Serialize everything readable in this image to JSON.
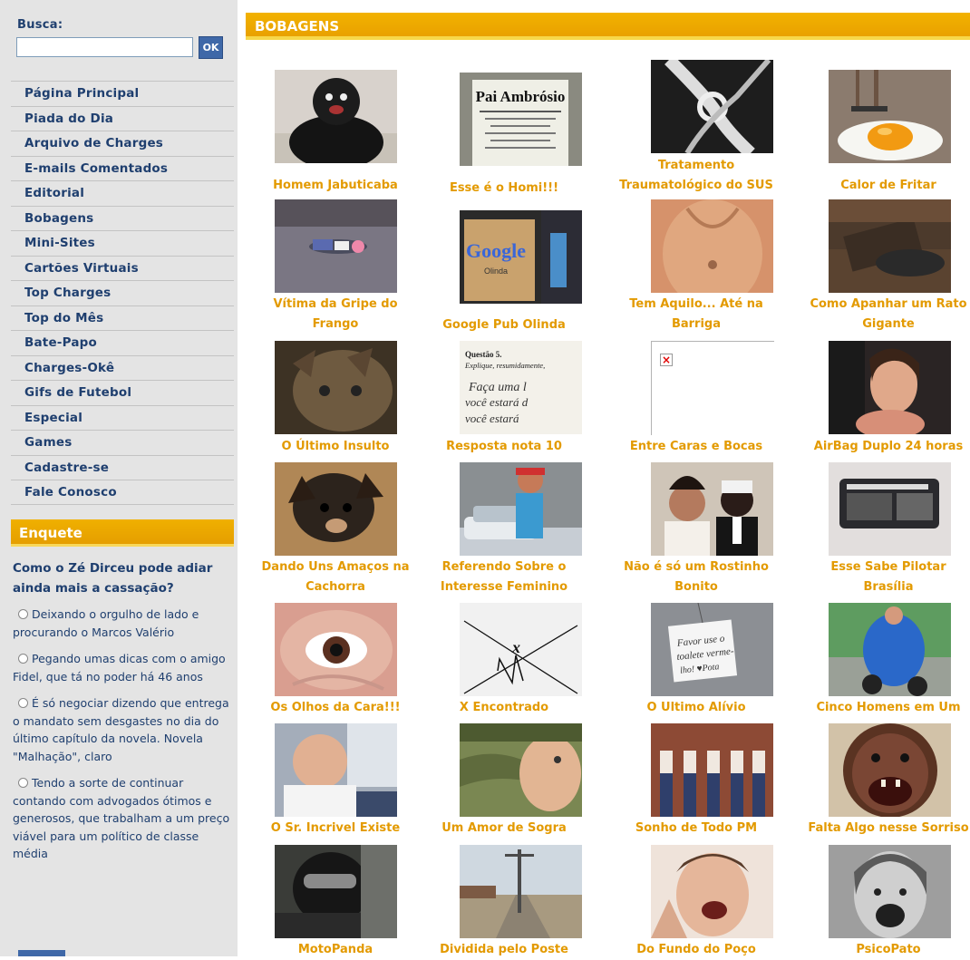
{
  "search": {
    "label": "Busca:",
    "value": "",
    "button": "OK"
  },
  "nav": [
    "Página Principal",
    "Piada do Dia",
    "Arquivo de Charges",
    "E-mails Comentados",
    "Editorial",
    "Bobagens",
    "Mini-Sites",
    "Cartões Virtuais",
    "Top Charges",
    "Top do Mês",
    "Bate-Papo",
    "Charges-Okê",
    "Gifs de Futebol",
    "Especial",
    "Games",
    "Cadastre-se",
    "Fale Conosco"
  ],
  "poll": {
    "header": "Enquete",
    "question": "Como o Zé Dirceu pode adiar ainda mais a cassação?",
    "options": [
      "Deixando o orgulho de lado e procurando o Marcos Valério",
      "Pegando umas dicas com o amigo Fidel, que tá no poder há 46 anos",
      "É só negociar dizendo que entrega o mandato sem desgastes no dia do último capítulo da novela. Novela \"Malhação\", claro",
      "Tendo a sorte de continuar contando com advogados ótimos e generosos, que trabalham a um preço viável para um político de classe média"
    ]
  },
  "section": {
    "title": "BOBAGENS"
  },
  "items": [
    {
      "caption": "Homem Jabuticaba",
      "image": "black-inflatable-man"
    },
    {
      "caption": "Esse é o Homi!!!",
      "image": "pai-ambrosio-sign",
      "sign_title": "Pai Ambrósio"
    },
    {
      "caption": "Tratamento Traumatológico do SUS",
      "image": "knotted-bone-xray"
    },
    {
      "caption": "Calor de Fritar",
      "image": "fried-egg-on-ground"
    },
    {
      "caption": "Vítima da Gripe do Frango",
      "image": "person-lying-on-road"
    },
    {
      "caption": "Google Pub Olinda",
      "image": "google-pub-sign",
      "sign_title": "Google",
      "sign_sub": "Olinda"
    },
    {
      "caption": "Tem Aquilo... Até na Barriga",
      "image": "belly-closeup"
    },
    {
      "caption": "Como Apanhar um Rato Gigante",
      "image": "giant-rat-trap"
    },
    {
      "caption": "O Último Insulto",
      "image": "cat-closeup"
    },
    {
      "caption": "Resposta nota 10",
      "image": "handwritten-exam-answer",
      "exam_lines": [
        "Questão 5.",
        "Explique, resumidamente,",
        "Faça uma l",
        "você estará d",
        "você estará"
      ]
    },
    {
      "caption": "Entre Caras e Bocas",
      "image": "broken-image"
    },
    {
      "caption": "AirBag Duplo 24 horas",
      "image": "woman-in-car"
    },
    {
      "caption": "Dando Uns Amaços na Cachorra",
      "image": "chihuahua-closeup"
    },
    {
      "caption": "Referendo Sobre o Interesse Feminino",
      "image": "man-with-car"
    },
    {
      "caption": "Não é só um Rostinho Bonito",
      "image": "wedding-couple"
    },
    {
      "caption": "Esse Sabe Pilotar Brasília",
      "image": "pink-car-window"
    },
    {
      "caption": "Os Olhos da Cara!!!",
      "image": "eye-in-hand"
    },
    {
      "caption": "X Encontrado",
      "image": "x-found-math"
    },
    {
      "caption": "O Ultimo Alívio",
      "image": "note-on-wall",
      "note_lines": [
        "Favor use o",
        "toalete verme-",
        "lho! ♥Pota"
      ]
    },
    {
      "caption": "Cinco Homens em Um",
      "image": "big-man-on-motorbike"
    },
    {
      "caption": "O Sr. Incrivel Existe",
      "image": "bald-man-office"
    },
    {
      "caption": "Um Amor de Sogra",
      "image": "crocodile-kiss"
    },
    {
      "caption": "Sonho de Todo PM",
      "image": "women-against-wall"
    },
    {
      "caption": "Falta Algo nesse Sorriso",
      "image": "toothless-smile"
    },
    {
      "caption": "MotoPanda",
      "image": "helmet-rider"
    },
    {
      "caption": "Dividida pelo Poste",
      "image": "street-with-pole"
    },
    {
      "caption": "Do Fundo do Poço",
      "image": "man-in-pain"
    },
    {
      "caption": "PsicoPato",
      "image": "screaming-woman-bw"
    }
  ]
}
